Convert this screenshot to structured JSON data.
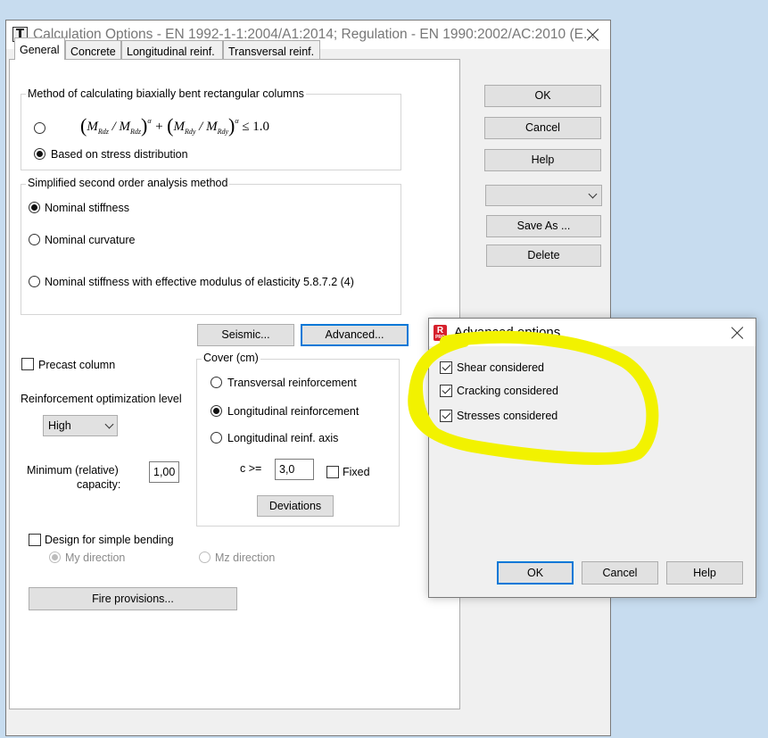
{
  "main_window": {
    "title": "Calculation Options - EN 1992-1-1:2004/A1:2014;   Regulation - EN 1990:2002/AC:2010  (E..."
  },
  "tabs": [
    {
      "label": "General",
      "active": true
    },
    {
      "label": "Concrete",
      "active": false
    },
    {
      "label": "Longitudinal reinf.",
      "active": false
    },
    {
      "label": "Transversal reinf.",
      "active": false
    }
  ],
  "biaxial": {
    "legend": "Method of calculating biaxially bent rectangular columns",
    "formula": {
      "m1": "M",
      "s1": "Rdz",
      "m2": "M",
      "s2": "Rdz",
      "exp": "α",
      "m3": "M",
      "s3": "Rdy",
      "m4": "M",
      "s4": "Rdy",
      "rhs": "≤ 1.0"
    },
    "option_stress": "Based on stress distribution"
  },
  "second_order": {
    "legend": "Simplified second order analysis method",
    "options": [
      "Nominal stiffness",
      "Nominal curvature",
      "Nominal stiffness with effective modulus of elasticity 5.8.7.2 (4)"
    ]
  },
  "buttons": {
    "seismic": "Seismic...",
    "advanced": "Advanced...",
    "ok": "OK",
    "cancel": "Cancel",
    "help": "Help",
    "save_as": "Save As ...",
    "delete": "Delete",
    "deviations": "Deviations",
    "fire": "Fire provisions..."
  },
  "precast": {
    "label": "Precast column"
  },
  "optimization": {
    "label": "Reinforcement optimization level",
    "value": "High"
  },
  "min_capacity": {
    "label_line1": "Minimum (relative)",
    "label_line2": "capacity:",
    "value": "1,00"
  },
  "cover": {
    "legend": "Cover (cm)",
    "options": [
      "Transversal reinforcement",
      "Longitudinal reinforcement",
      "Longitudinal reinf. axis"
    ],
    "c_label": "c >=",
    "c_value": "3,0",
    "fixed_label": "Fixed"
  },
  "simple_bending": {
    "label": "Design for simple bending",
    "my": "My direction",
    "mz": "Mz direction"
  },
  "advanced_dialog": {
    "title": "Advanced options",
    "icon_letter": "R",
    "icon_sub": "PRO",
    "checks": [
      "Shear considered",
      "Cracking considered",
      "Stresses considered"
    ],
    "ok": "OK",
    "cancel": "Cancel",
    "help": "Help"
  },
  "colors": {
    "highlight": "#f2f200",
    "focus_blue": "#0078d7"
  }
}
